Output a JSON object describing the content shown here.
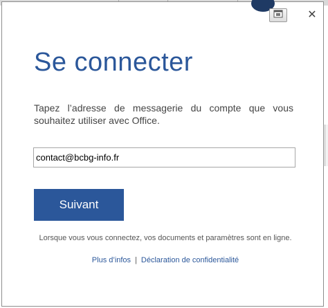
{
  "dialog": {
    "title": "Se connecter",
    "instructions": "Tapez l’adresse de messagerie du compte que vous souhaitez utiliser avec Office.",
    "email_value": "contact@bcbg-info.fr",
    "next_label": "Suivant",
    "footer_text": "Lorsque vous vous connectez, vos documents et paramètres sont en ligne.",
    "more_info_label": "Plus d’infos",
    "separator": "|",
    "privacy_label": "Déclaration de confidentialité",
    "close_glyph": "✕"
  },
  "colors": {
    "accent": "#2b579a",
    "text": "#444444"
  },
  "icons": {
    "options": "options-icon",
    "close": "close-icon"
  }
}
